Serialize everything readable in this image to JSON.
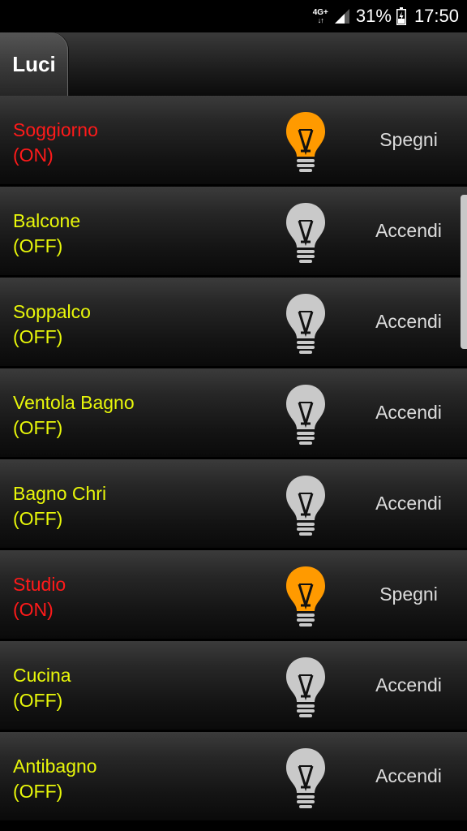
{
  "status_bar": {
    "network_type": "4G+",
    "network_arrows": "↓↑",
    "battery_percent": "31%",
    "time": "17:50",
    "icons": [
      "network-4g-icon",
      "signal-icon",
      "battery-icon"
    ]
  },
  "tab": {
    "label": "Luci"
  },
  "colors": {
    "on_text": "#ff1a1a",
    "off_text": "#e8f70a",
    "bulb_on": "#ff9a00",
    "bulb_off": "#c9c9c9",
    "action_text": "#dcdcdc"
  },
  "lights": [
    {
      "name": "Soggiorno",
      "state": "(ON)",
      "on": true,
      "action": "Spegni"
    },
    {
      "name": "Balcone",
      "state": "(OFF)",
      "on": false,
      "action": "Accendi"
    },
    {
      "name": "Soppalco",
      "state": "(OFF)",
      "on": false,
      "action": "Accendi"
    },
    {
      "name": "Ventola Bagno",
      "state": "(OFF)",
      "on": false,
      "action": "Accendi"
    },
    {
      "name": "Bagno Chri",
      "state": "(OFF)",
      "on": false,
      "action": "Accendi"
    },
    {
      "name": "Studio",
      "state": "(ON)",
      "on": true,
      "action": "Spegni"
    },
    {
      "name": "Cucina",
      "state": "(OFF)",
      "on": false,
      "action": "Accendi"
    },
    {
      "name": "Antibagno",
      "state": "(OFF)",
      "on": false,
      "action": "Accendi"
    }
  ]
}
